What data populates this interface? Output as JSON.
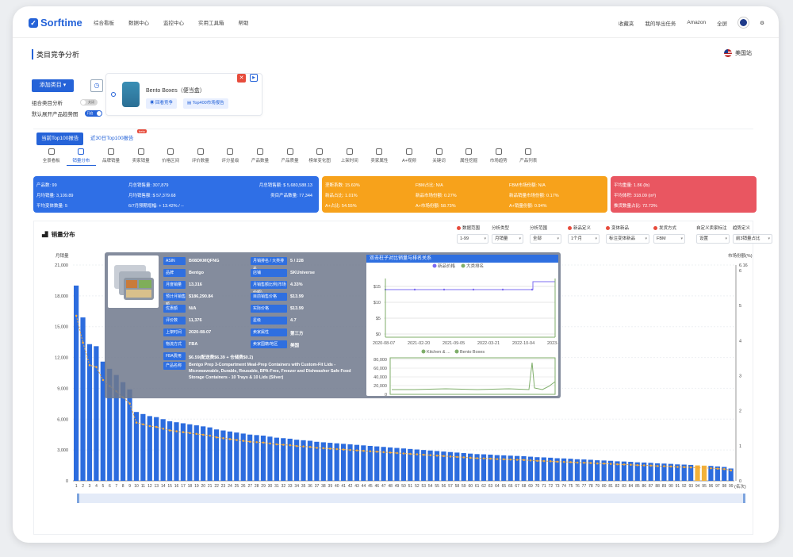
{
  "app": {
    "logo": "Sorftime",
    "nav": [
      "综合看板",
      "数据中心",
      "监控中心",
      "实用工具箱",
      "帮助"
    ],
    "right": [
      "收藏夹",
      "我的导出任务",
      "Amazon",
      "全屏"
    ]
  },
  "page": {
    "title": "类目竞争分析",
    "site": "美国站",
    "add_btn": "添加类目",
    "opt1": "组合类目分析",
    "opt1_state": "关闭",
    "opt2": "默认展开产品趋势图",
    "opt2_state": "开启",
    "product_name": "Bento Boxes（便当盒）",
    "btn_back": "回看竞争",
    "btn_report": "Top400市场报告"
  },
  "tabs": {
    "top": [
      "当前Top100报告",
      "近30日Top100报告"
    ],
    "beta": "beta",
    "items": [
      "全景看板",
      "销量分布",
      "品牌销量",
      "卖家销量",
      "价格区间",
      "评价数量",
      "评分星级",
      "产品数量",
      "产品质量",
      "榜单变化图",
      "上架时间",
      "卖家属性",
      "A+视频",
      "关键词",
      "属性挖掘",
      "市场趋势",
      "产品列表"
    ],
    "active": 1
  },
  "stats": {
    "blue": [
      [
        "产品数: 99",
        "月总销售量: 307,879",
        "月总销售额: $ 5,680,588.13"
      ],
      [
        "月均销量: 3,109.89",
        "月均销售额: $ 57,379.68",
        "类目产品数量: 77,344"
      ],
      [
        "平均变体数量: 5",
        "6/7月预期增幅: + 13.42% / --",
        ""
      ]
    ],
    "orange": [
      [
        "垄断系数: 15.60%",
        "FBM占比: N/A",
        "FBM市场份额: N/A"
      ],
      [
        "新品占比: 1.01%",
        "新品市场份额: 0.27%",
        "新品销量市场份额: 0.17%"
      ],
      [
        "A+占比: 54.55%",
        "A+市场份额: 58.73%",
        "A+销量份额: 0.94%"
      ]
    ],
    "red": [
      [
        "平均重量: 1.86 (lb)"
      ],
      [
        "平均体积: 318.09 (in³)"
      ],
      [
        "推货数量占比: 72.73%"
      ]
    ]
  },
  "chart": {
    "title": "销量分布",
    "filters": [
      {
        "label": "数据范围",
        "value": "1-99"
      },
      {
        "label": "分析类型",
        "value": "月销量"
      },
      {
        "label": "分析范围",
        "value": "全部"
      },
      {
        "label": "新品定义",
        "value": "1个月"
      },
      {
        "label": "变体新品",
        "value": "标注变体新品"
      },
      {
        "label": "发货方式",
        "value": "FBM"
      },
      {
        "label": "自定义卖家标注",
        "value": "设置"
      },
      {
        "label": "趋势定义",
        "value": "前3销量占比"
      }
    ],
    "ylabel_left": "月销量",
    "ylabel_right": "市场份额(%)",
    "xlabel": "(名次)"
  },
  "chart_data": {
    "type": "bar",
    "title": "销量分布",
    "xlabel": "(名次)",
    "ylabel": "月销量",
    "ylim": [
      0,
      21000
    ],
    "y2lim": [
      0,
      6.16
    ],
    "yticks": [
      0,
      3000,
      6000,
      9000,
      12000,
      15000,
      18000,
      21000
    ],
    "y2ticks": [
      0,
      1,
      2,
      3,
      4,
      5,
      6,
      6.16
    ],
    "categories": [
      "1",
      "2",
      "3",
      "4",
      "5",
      "6",
      "7",
      "8",
      "9",
      "10",
      "11",
      "12",
      "13",
      "14",
      "15",
      "16",
      "17",
      "18",
      "19",
      "20",
      "21",
      "22",
      "23",
      "24",
      "25",
      "26",
      "27",
      "28",
      "29",
      "30",
      "31",
      "32",
      "33",
      "34",
      "35",
      "36",
      "37",
      "38",
      "39",
      "40",
      "41",
      "42",
      "43",
      "44",
      "45",
      "46",
      "47",
      "48",
      "49",
      "50",
      "51",
      "52",
      "53",
      "54",
      "55",
      "56",
      "57",
      "58",
      "59",
      "60",
      "61",
      "62",
      "63",
      "64",
      "65",
      "66",
      "67",
      "68",
      "69",
      "70",
      "71",
      "72",
      "73",
      "74",
      "75",
      "76",
      "77",
      "78",
      "79",
      "80",
      "81",
      "82",
      "83",
      "84",
      "85",
      "86",
      "87",
      "88",
      "89",
      "90",
      "91",
      "92",
      "93",
      "94",
      "95",
      "96",
      "97",
      "98",
      "99"
    ],
    "series": [
      {
        "name": "月销量",
        "values": [
          19000,
          15900,
          13300,
          13100,
          11600,
          10900,
          10300,
          9600,
          8900,
          6700,
          6500,
          6300,
          6200,
          6000,
          5800,
          5700,
          5600,
          5500,
          5400,
          5300,
          5200,
          5000,
          4900,
          4800,
          4700,
          4600,
          4500,
          4450,
          4400,
          4300,
          4200,
          4150,
          4100,
          4000,
          3950,
          3900,
          3800,
          3750,
          3700,
          3650,
          3600,
          3550,
          3500,
          3450,
          3400,
          3350,
          3300,
          3250,
          3200,
          3150,
          3100,
          3050,
          3000,
          2950,
          2900,
          2850,
          2800,
          2750,
          2700,
          2650,
          2600,
          2580,
          2550,
          2500,
          2480,
          2450,
          2420,
          2400,
          2350,
          2300,
          2280,
          2250,
          2200,
          2180,
          2150,
          2100,
          2080,
          2050,
          2000,
          1980,
          1950,
          1900,
          1880,
          1850,
          1800,
          1780,
          1750,
          1700,
          1680,
          1650,
          1600,
          1580,
          1550,
          1500,
          1480,
          1450,
          1400,
          1350,
          1200
        ]
      }
    ]
  },
  "tooltip": {
    "rows": [
      [
        "ASIN",
        "B08DKMQFNG"
      ],
      [
        "品牌",
        "Bentgo"
      ],
      [
        "月度销量",
        "13,316"
      ],
      [
        "预计月销售额",
        "$186,290.84"
      ],
      [
        "优惠额",
        "N/A"
      ],
      [
        "评价数",
        "11,376"
      ],
      [
        "上架时间",
        "2020-08-07"
      ],
      [
        "物流方式",
        "FBA"
      ],
      [
        "FBA费用",
        "$6.59(配送费$6.39 + 仓储费$0.2)"
      ]
    ],
    "rows2": [
      [
        "月销排名 / 大类排名",
        "5 / 228"
      ],
      [
        "店铺",
        "SKUniverse"
      ],
      [
        "月销售额比例(市场份额)",
        "4.33%"
      ],
      [
        "目前销售价格",
        "$13.99"
      ],
      [
        "实际价格",
        "$13.99"
      ],
      [
        "星级",
        "4.7"
      ],
      [
        "卖家属性",
        "第三方"
      ],
      [
        "卖家国籍/地区",
        "美国"
      ]
    ],
    "name_label": "产品名称",
    "name": "Bentgo Prep 3-Compartment Meal-Prep Containers with Custom-Fit Lids - Microwaveable, Durable, Reusable, BPA-Free, Freezer and Dishwasher Safe Food Storage Containers - 10 Trays & 10 Lids (Silver)",
    "mini_title": "双击柱子对比销量与排名关系",
    "legend1": [
      "新品价格",
      "大类排名"
    ],
    "legend2": [
      "Kitchen & ...",
      "Bento Boxes"
    ],
    "price_ticks": [
      "$15",
      "$10",
      "$5",
      "$0"
    ],
    "rank_ticks": [
      "80,000",
      "60,000",
      "40,000",
      "20,000",
      "0"
    ],
    "dates": [
      "2020-08-07",
      "2021-02-20",
      "2021-09-05",
      "2022-03-21",
      "2022-10-04",
      "2023-0"
    ]
  }
}
